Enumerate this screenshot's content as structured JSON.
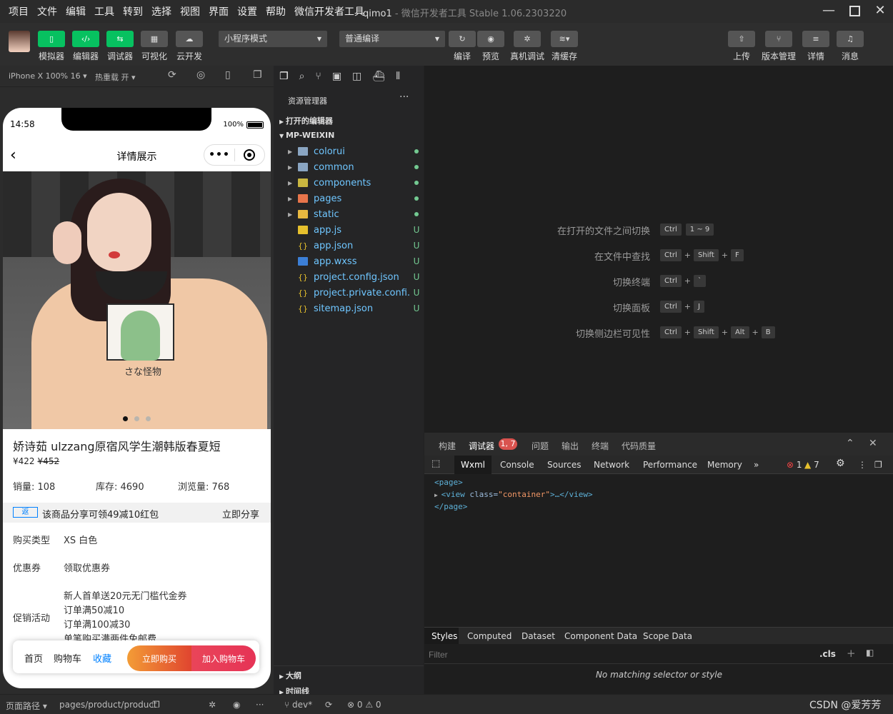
{
  "menu": [
    "项目",
    "文件",
    "编辑",
    "工具",
    "转到",
    "选择",
    "视图",
    "界面",
    "设置",
    "帮助",
    "微信开发者工具"
  ],
  "window": {
    "project": "qimo1",
    "title_rest": " - 微信开发者工具 Stable 1.06.2303220"
  },
  "toolbar": {
    "labels": [
      "模拟器",
      "编辑器",
      "调试器",
      "可视化",
      "云开发"
    ],
    "mode": "小程序模式",
    "compile_mode": "普通编译",
    "actions": [
      "编译",
      "预览",
      "真机调试",
      "清缓存"
    ],
    "right": [
      "上传",
      "版本管理",
      "详情",
      "消息"
    ]
  },
  "subbar": {
    "device": "iPhone X 100% 16 ▾",
    "hotreload": "热重载 开 ▾"
  },
  "phone": {
    "time": "14:58",
    "battery": "100%",
    "nav_title": "详情展示",
    "capsule_dots": "•••",
    "print_text": "さな怪物",
    "product_title": "娇诗茹 ulzzang原宿风学生潮韩版春夏短",
    "price": "¥422",
    "old_price": "¥452",
    "sales": "销量: 108",
    "stock": "库存: 4690",
    "views": "浏览量: 768",
    "share_tag": "返",
    "share_text": "该商品分享可领49减10红包",
    "share_btn": "立即分享",
    "buy_type_label": "购买类型",
    "buy_type_value": "XS 白色",
    "coupon_label": "优惠券",
    "coupon_value": "领取优惠券",
    "promo_label": "促销活动",
    "promos": [
      "新人首单送20元无门槛代金券",
      "订单满50减10",
      "订单满100减30",
      "单笔购买满两件免邮费"
    ],
    "bottom": {
      "home": "首页",
      "cart": "购物车",
      "fav": "收藏",
      "buy": "立即购买",
      "add_cart": "加入购物车"
    }
  },
  "explorer": {
    "title": "资源管理器",
    "more": "···",
    "open_editors": "打开的编辑器",
    "root": "MP-WEIXIN",
    "folders": [
      "colorui",
      "common",
      "components",
      "pages",
      "static"
    ],
    "files": [
      {
        "name": "app.js",
        "status": "U",
        "icon": "js-icon"
      },
      {
        "name": "app.json",
        "status": "U",
        "icon": "json-icon"
      },
      {
        "name": "app.wxss",
        "status": "U",
        "icon": "css-icon"
      },
      {
        "name": "project.config.json",
        "status": "U",
        "icon": "json-icon"
      },
      {
        "name": "project.private.confi...",
        "status": "U",
        "icon": "json-icon"
      },
      {
        "name": "sitemap.json",
        "status": "U",
        "icon": "json-icon"
      }
    ],
    "outline": "大纲",
    "timeline": "时间线"
  },
  "editor": {
    "hints": [
      {
        "label": "在打开的文件之间切换",
        "keys": [
          "Ctrl",
          "1 ~ 9"
        ]
      },
      {
        "label": "在文件中查找",
        "keys": [
          "Ctrl",
          "Shift",
          "F"
        ]
      },
      {
        "label": "切换终端",
        "keys": [
          "Ctrl",
          "`"
        ]
      },
      {
        "label": "切换面板",
        "keys": [
          "Ctrl",
          "J"
        ]
      },
      {
        "label": "切换侧边栏可见性",
        "keys": [
          "Ctrl",
          "Shift",
          "Alt",
          "B"
        ]
      }
    ]
  },
  "devtools": {
    "tabs": [
      "构建",
      "调试器",
      "问题",
      "输出",
      "终端",
      "代码质量"
    ],
    "badge": "1, 7",
    "chrome_tabs": [
      "Wxml",
      "Console",
      "Sources",
      "Network",
      "Performance",
      "Memory"
    ],
    "err_count": "1",
    "warn_count": "7",
    "code": {
      "page_open": "<page>",
      "view_tag": "<view",
      "attr": " class=",
      "val": "\"container\"",
      "close": ">…</view>",
      "page_close": "</page>"
    },
    "style_tabs": [
      "Styles",
      "Computed",
      "Dataset",
      "Component Data",
      "Scope Data"
    ],
    "filter_placeholder": "Filter",
    "cls": ".cls",
    "no_match": "No matching selector or style"
  },
  "status": {
    "path_label": "页面路径 ▾",
    "path": "pages/product/product",
    "branch": "dev*",
    "errors": "⊗ 0 ⚠ 0",
    "watermark": "CSDN @爱芳芳"
  },
  "colors": {
    "accent": "#07c160",
    "link": "#0081ff",
    "buy": "#f39c36",
    "cart": "#e63356"
  }
}
